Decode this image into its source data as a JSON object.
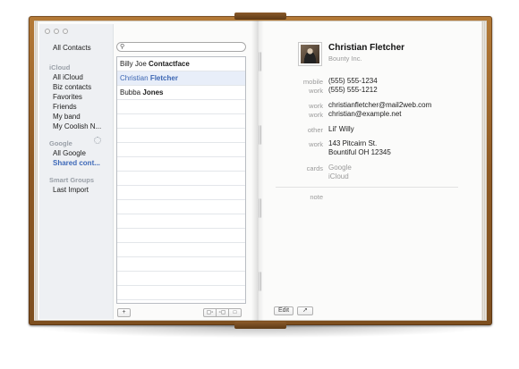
{
  "window": {
    "controls": [
      "close",
      "minimize",
      "zoom"
    ]
  },
  "sidebar": {
    "all_contacts": "All Contacts",
    "groups": [
      {
        "header": "iCloud",
        "items": [
          "All iCloud",
          "Biz contacts",
          "Favorites",
          "Friends",
          "My band",
          "My Coolish N..."
        ]
      },
      {
        "header": "Google",
        "items": [
          "All Google",
          "Shared cont..."
        ],
        "selected": "Shared cont..."
      },
      {
        "header": "Smart Groups",
        "items": [
          "Last Import"
        ]
      }
    ]
  },
  "search": {
    "placeholder": "",
    "icon": "search-icon"
  },
  "contacts": [
    {
      "first": "Billy Joe",
      "last": "Contactface",
      "selected": false
    },
    {
      "first": "Christian",
      "last": "Fletcher",
      "selected": true
    },
    {
      "first": "Bubba",
      "last": "Jones",
      "selected": false
    }
  ],
  "list_toolbar": {
    "add": "+",
    "view_icons": [
      "card-list-view-icon",
      "list-view-icon",
      "card-view-icon"
    ]
  },
  "detail": {
    "name": "Christian Fletcher",
    "company": "Bounty Inc.",
    "fields": [
      {
        "label": "mobile",
        "value": "(555) 555-1234"
      },
      {
        "label": "work",
        "value": "(555) 555-1212"
      },
      {
        "label": "work",
        "value": "christianfletcher@mail2web.com"
      },
      {
        "label": "work",
        "value": "christian@example.net"
      },
      {
        "label": "other",
        "value": "Lil' Willy"
      },
      {
        "label": "work",
        "value": "143 Pitcairn St.",
        "value2": "Bountiful OH 12345"
      },
      {
        "label": "cards",
        "value": "Google",
        "value2": "iCloud"
      }
    ],
    "note_label": "note",
    "edit_label": "Edit",
    "share_icon": "share-icon"
  },
  "colors": {
    "cover": "#9a6530",
    "selection": "#3c66b3",
    "page": "#fbfbfa"
  }
}
